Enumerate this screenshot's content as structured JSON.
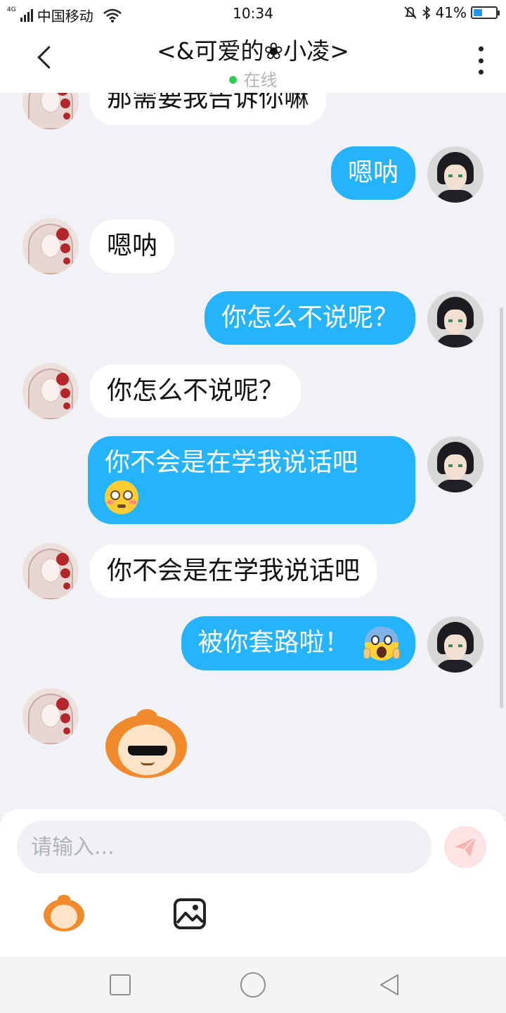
{
  "status_bar": {
    "network": "4G",
    "carrier": "中国移动",
    "time": "10:34",
    "battery": "41%",
    "battery_level": 0.41
  },
  "header": {
    "title": "<&可爱的❀小凌>",
    "status": "在线"
  },
  "messages": [
    {
      "side": "left",
      "text": "那需要我告诉你嘛"
    },
    {
      "side": "right",
      "text": "嗯呐"
    },
    {
      "side": "left",
      "text": "嗯呐"
    },
    {
      "side": "right",
      "text": "你怎么不说呢？"
    },
    {
      "side": "left",
      "text": "你怎么不说呢？"
    },
    {
      "side": "right",
      "text": "你不会是在学我说话吧",
      "emoji": "flushed-face"
    },
    {
      "side": "left",
      "text": "你不会是在学我说话吧"
    },
    {
      "side": "right",
      "text": "被你套路啦！",
      "emoji": "screaming-face"
    },
    {
      "side": "left",
      "sticker": "sunglasses-monkey-sticker"
    }
  ],
  "input": {
    "placeholder": "请输入..."
  },
  "colors": {
    "outgoing_bubble": "#25b4fb",
    "incoming_bubble": "#ffffff",
    "chat_background": "#f1f2f6",
    "online_dot": "#2ecc55"
  }
}
